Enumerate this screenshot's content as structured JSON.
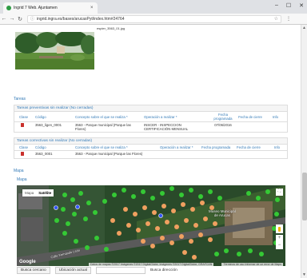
{
  "browser": {
    "tab_title": "Ingrid 7 Web. Ajuntamen",
    "tab_close": "×",
    "url": "ingrid.ingra.es/bases/arucasPyt/index.htm#24764",
    "win_min": "–",
    "win_max": "☐",
    "win_close": "✕",
    "back": "←",
    "forward": "→",
    "reload": "↻",
    "star": "☆",
    "menu": "⋮"
  },
  "photo": {
    "caption": "espier_3563_01.jpg"
  },
  "tareas": {
    "title": "Tareas",
    "preventivas": {
      "heading": "Tareas preventivas sin realizar (No cerradas)",
      "columns": [
        "Clase",
        "Código",
        "Concepto sobre el que se realiza *",
        "Operación a realizar *",
        "Fecha programada",
        "Fecha de cierre",
        "Info"
      ],
      "rows": [
        {
          "codigo": "3563_ligen_0001",
          "concepto": "3563 - Parque municipal (Parque las Flores)",
          "operacion": "INSCER - INSPECCION CERTIFICACIÓN MENSUAL",
          "fecha_programada": "07/06/2016",
          "fecha_cierre": "",
          "info": ""
        }
      ]
    },
    "correctivas": {
      "heading": "Tareas correctivas sin realizar (No cerradas)",
      "columns": [
        "Clase",
        "Código",
        "Concepto sobre el que se realiza *",
        "Operación a realizar *",
        "Fecha programada",
        "Fecha de cierre",
        "Info"
      ],
      "rows": [
        {
          "codigo": "3563_0001",
          "concepto": "3563 - Parque municipal (Parque las Flores)",
          "operacion": "",
          "fecha_programada": "",
          "fecha_cierre": "",
          "info": ""
        }
      ]
    }
  },
  "mapa": {
    "title": "Mapa",
    "inner_title": "Mapa",
    "toggle_map": "Mapa",
    "toggle_sat": "Satélite",
    "fullscreen": "⛶",
    "zoom_in": "+",
    "zoom_out": "−",
    "museum_label": "Museo Municipal\nde Arucas",
    "street_label": "Calle Fernando León",
    "google": "Google",
    "attribution": "Datos de mapas ©2017 Imágenes ©2017 DigitalGlobe, Imágenes ©2017 DigitalGlobe, GRAFCAN",
    "terms": "Términos de uso   Informar de un error de Maps"
  },
  "bottom": {
    "buscar_cercano": "Busca cercano",
    "ubicacion_actual": "Ubicación actual",
    "busca_direccion": "Busca dirección"
  }
}
